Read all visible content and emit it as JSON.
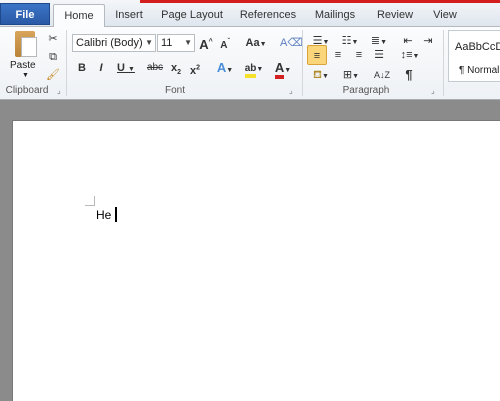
{
  "tabs": [
    {
      "label": "File"
    },
    {
      "label": "Home"
    },
    {
      "label": "Insert"
    },
    {
      "label": "Page Layout"
    },
    {
      "label": "References"
    },
    {
      "label": "Mailings"
    },
    {
      "label": "Review"
    },
    {
      "label": "View"
    }
  ],
  "clipboard": {
    "paste_label": "Paste",
    "group_label": "Clipboard"
  },
  "font": {
    "name": "Calibri (Body)",
    "size": "11",
    "group_label": "Font",
    "case_label": "Aa"
  },
  "paragraph": {
    "group_label": "Paragraph"
  },
  "styles": {
    "sample": "AaBbCcD",
    "normal_label": "¶ Normal"
  },
  "document": {
    "text": "He"
  },
  "colors": {
    "accent": "#2a5aa6",
    "highlight": "#f5e12a",
    "font_color": "#d42020",
    "selected_bg": "#fbd57a"
  }
}
